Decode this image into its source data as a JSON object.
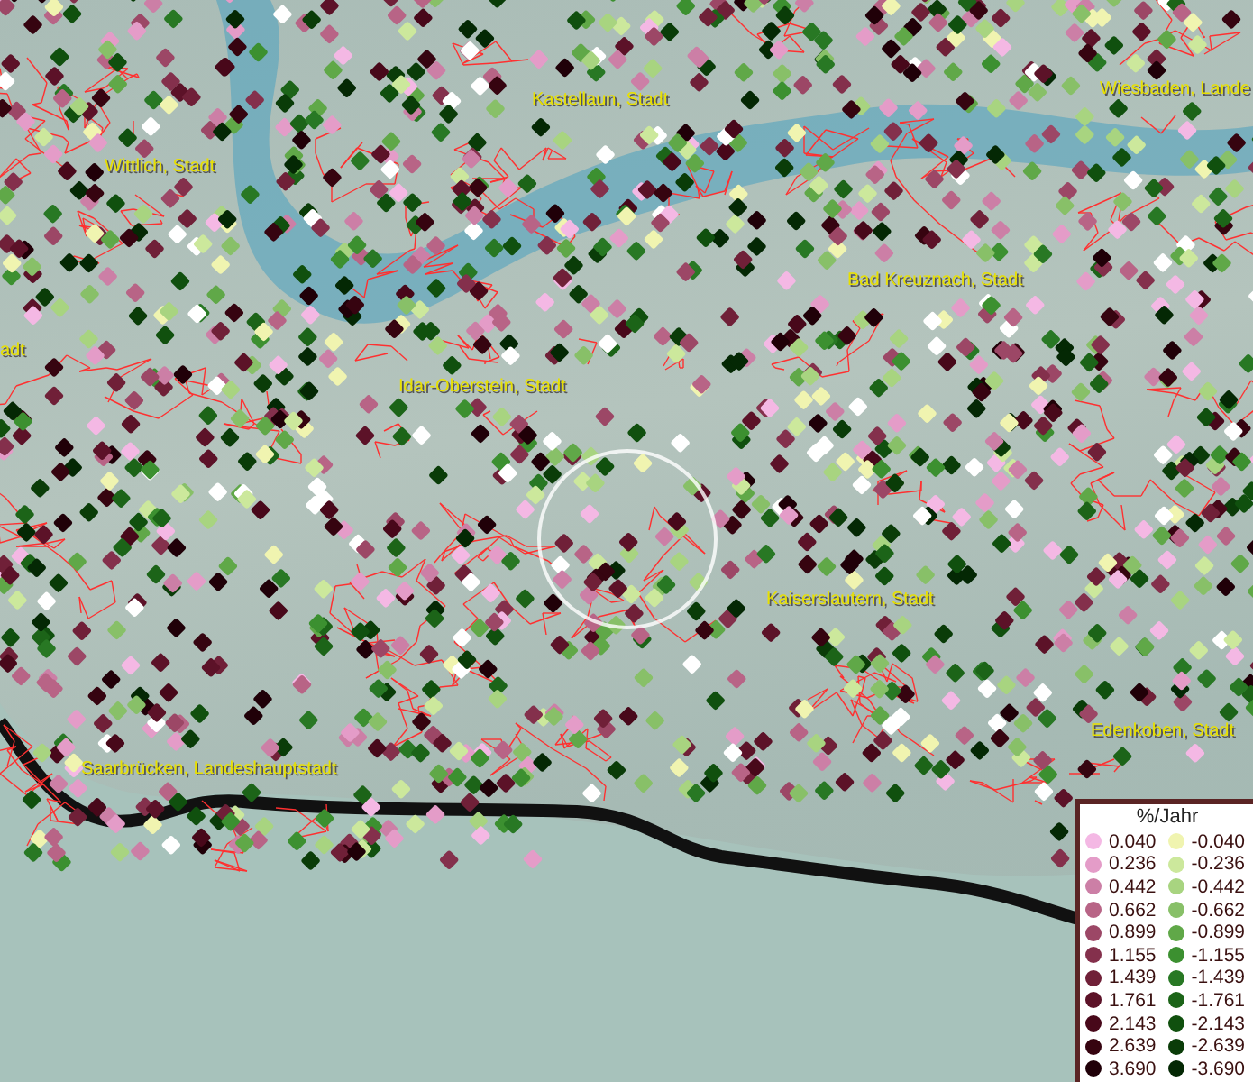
{
  "map": {
    "place_labels": [
      {
        "text": "Kastellaun, Stadt"
      },
      {
        "text": "Wiesbaden, Lande"
      },
      {
        "text": "Wittlich, Stadt"
      },
      {
        "text": "Bad Kreuznach, Stadt"
      },
      {
        "text": "adt"
      },
      {
        "text": "Idar-Oberstein, Stadt"
      },
      {
        "text": "Kaiserslautern, Stadt"
      },
      {
        "text": "Edenkoben, Stadt"
      },
      {
        "text": "Saarbrücken, Landeshauptstadt"
      }
    ]
  },
  "legend": {
    "title": "%/Jahr",
    "positive": [
      {
        "value": "0.040",
        "color": "#f4b8e4"
      },
      {
        "value": "0.236",
        "color": "#e49cc8"
      },
      {
        "value": "0.442",
        "color": "#cc7fa6"
      },
      {
        "value": "0.662",
        "color": "#b86486"
      },
      {
        "value": "0.899",
        "color": "#9c4766"
      },
      {
        "value": "1.155",
        "color": "#84304c"
      },
      {
        "value": "1.439",
        "color": "#702038"
      },
      {
        "value": "1.761",
        "color": "#5c1228"
      },
      {
        "value": "2.143",
        "color": "#48081a"
      },
      {
        "value": "2.639",
        "color": "#360410"
      },
      {
        "value": "3.690",
        "color": "#200008"
      }
    ],
    "negative": [
      {
        "value": "-0.040",
        "color": "#f0f4b0"
      },
      {
        "value": "-0.236",
        "color": "#cce89c"
      },
      {
        "value": "-0.442",
        "color": "#a8d480"
      },
      {
        "value": "-0.662",
        "color": "#88c068"
      },
      {
        "value": "-0.899",
        "color": "#60a848"
      },
      {
        "value": "-1.155",
        "color": "#3c9030"
      },
      {
        "value": "-1.439",
        "color": "#287824"
      },
      {
        "value": "-1.761",
        "color": "#1c6418"
      },
      {
        "value": "-2.143",
        "color": "#10500e"
      },
      {
        "value": "-2.639",
        "color": "#0a3c08"
      },
      {
        "value": "-3.690",
        "color": "#042804"
      }
    ]
  }
}
